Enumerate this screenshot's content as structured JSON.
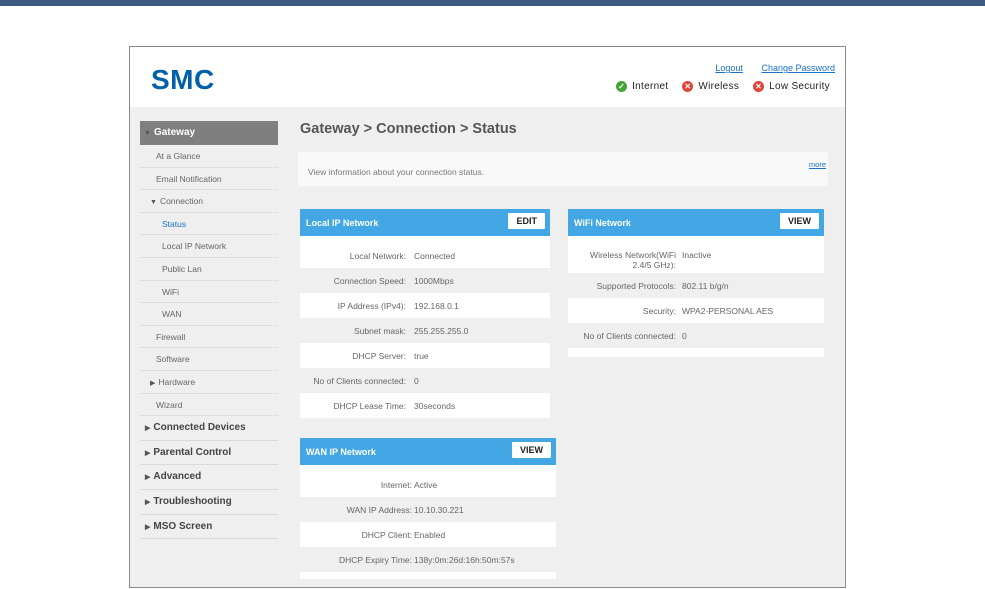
{
  "header": {
    "logo": "SMC",
    "logout": "Logout",
    "change_password": "Change Password",
    "status": [
      {
        "label": "Internet",
        "state": "ok"
      },
      {
        "label": "Wireless",
        "state": "bad"
      },
      {
        "label": "Low Security",
        "state": "bad"
      }
    ]
  },
  "sidebar": {
    "head": "Gateway",
    "items": [
      {
        "label": "At a Glance",
        "level": "l1"
      },
      {
        "label": "Email Notification",
        "level": "l1"
      },
      {
        "label": "Connection",
        "level": "l2",
        "expanded": true
      },
      {
        "label": "Status",
        "level": "l3",
        "active": true
      },
      {
        "label": "Local IP Network",
        "level": "l3"
      },
      {
        "label": "Public Lan",
        "level": "l3"
      },
      {
        "label": "WiFi",
        "level": "l3"
      },
      {
        "label": "WAN",
        "level": "l3"
      },
      {
        "label": "Firewall",
        "level": "l1"
      },
      {
        "label": "Software",
        "level": "l1"
      },
      {
        "label": "Hardware",
        "level": "l2",
        "expanded": false
      },
      {
        "label": "Wizard",
        "level": "l1"
      }
    ],
    "sections": [
      "Connected Devices",
      "Parental Control",
      "Advanced",
      "Troubleshooting",
      "MSO Screen"
    ]
  },
  "main": {
    "breadcrumb": "Gateway > Connection > Status",
    "info": "View information about your connection status.",
    "more": "more"
  },
  "cards": {
    "local": {
      "title": "Local IP Network",
      "button": "EDIT",
      "rows": [
        {
          "label": "Local Network:",
          "value": "Connected"
        },
        {
          "label": "Connection Speed:",
          "value": "1000Mbps"
        },
        {
          "label": "IP Address (IPv4):",
          "value": "192.168.0.1"
        },
        {
          "label": "Subnet mask:",
          "value": "255.255.255.0"
        },
        {
          "label": "DHCP Server:",
          "value": "true"
        },
        {
          "label": "No of Clients connected:",
          "value": "0"
        },
        {
          "label": "DHCP Lease Time:",
          "value": "30seconds"
        }
      ]
    },
    "wan": {
      "title": "WAN IP Network",
      "button": "VIEW",
      "rows": [
        {
          "label": "Internet:",
          "value": "Active"
        },
        {
          "label": "WAN IP Address:",
          "value": "10.10.30.221"
        },
        {
          "label": "DHCP Client:",
          "value": "Enabled"
        },
        {
          "label": "DHCP Expiry Time:",
          "value": "138y:0m:26d:16h:50m:57s"
        }
      ]
    },
    "wifi": {
      "title": "WiFi Network",
      "button": "VIEW",
      "rows": [
        {
          "label": "Wireless Network(WiFi 2.4/5 GHz):",
          "value": "Inactive"
        },
        {
          "label": "Supported Protocols:",
          "value": "802.11 b/g/n"
        },
        {
          "label": "Security:",
          "value": "WPA2-PERSONAL AES"
        },
        {
          "label": "No of Clients connected:",
          "value": "0"
        }
      ]
    }
  },
  "colors": {
    "brand": "#0060a8",
    "card_header": "#42a7e4",
    "sidebar_head": "#7f7f7f",
    "ok": "#44a436",
    "bad": "#e0433a",
    "topbar": "#3d5a80"
  }
}
